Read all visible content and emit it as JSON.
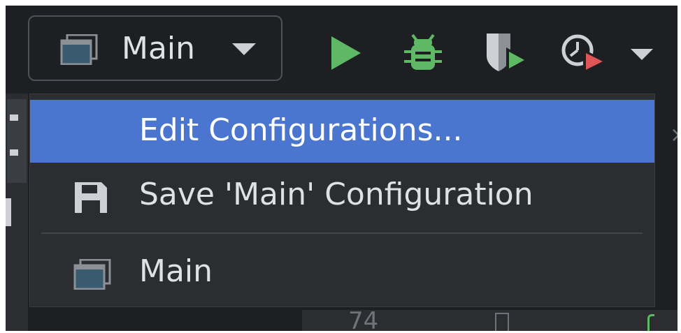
{
  "toolbar": {
    "run_config": {
      "label": "Main",
      "icon": "application-window-icon"
    },
    "buttons": [
      {
        "name": "run-button",
        "icon": "play-icon",
        "color": "#5fb865"
      },
      {
        "name": "debug-button",
        "icon": "bug-icon",
        "color": "#5fb865"
      },
      {
        "name": "coverage-button",
        "icon": "shield-run-icon"
      },
      {
        "name": "profiler-button",
        "icon": "clock-run-icon"
      },
      {
        "name": "more-actions-button",
        "icon": "chevron-down-icon"
      }
    ]
  },
  "popup_menu": {
    "items": [
      {
        "label": "Edit Configurations...",
        "selected": true,
        "icon": ""
      },
      {
        "label": "Save 'Main' Configuration",
        "selected": false,
        "icon": "floppy-disk-icon"
      },
      {
        "label": "Main",
        "selected": false,
        "icon": "application-window-icon"
      }
    ]
  },
  "editor": {
    "line_number": "74"
  },
  "colors": {
    "background": "#1e1f22",
    "popup_background": "#2b2d30",
    "selection": "#4a76cf",
    "text": "#dfe1e5",
    "run_green": "#5fb865",
    "profiler_red": "#e05555"
  }
}
